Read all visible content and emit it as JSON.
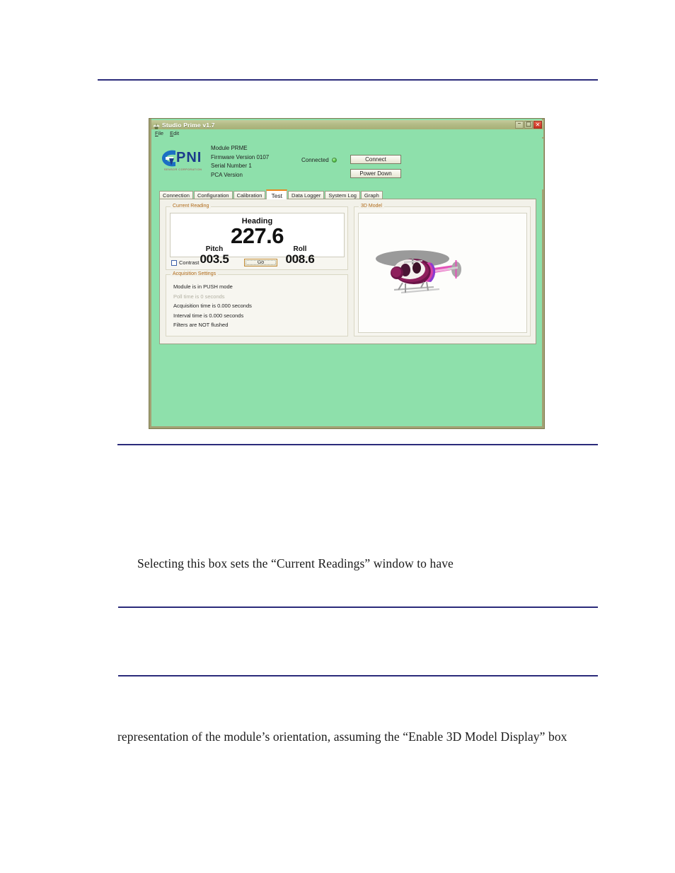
{
  "document": {
    "paragraph_1": "Selecting this box sets the “Current Readings” window to have",
    "paragraph_2": "representation of the module’s orientation, assuming the “Enable 3D Model Display” box",
    "rule_color": "#2b2b7a"
  },
  "app": {
    "title": "Studio Prime v1.7",
    "title_icon": "app-logo-icon",
    "window_buttons": {
      "minimize": "–",
      "maximize": "❐",
      "close": "✕"
    },
    "menu": [
      {
        "label": "File",
        "mnemonic": "F"
      },
      {
        "label": "Edit",
        "mnemonic": "E"
      }
    ],
    "colors": {
      "window_background": "#8ee0ab",
      "titlebar": "#b3bb86",
      "panel": "#f2f1e9",
      "group_legend": "#b06a18",
      "selected_tab_accent": "#e8861e",
      "led_green": "#4cc242",
      "logo_blue": "#1b3a8c"
    },
    "header": {
      "logo": {
        "wordmark": "PNI",
        "tagline": "SENSOR CORPORATION"
      },
      "module_info": [
        "Module PRME",
        "Firmware Version 0107",
        "Serial Number 1",
        "PCA Version"
      ],
      "connection": {
        "status_label": "Connected",
        "led": "connected-led",
        "connect_button": "Connect",
        "power_down_button": "Power Down"
      }
    },
    "tabs": [
      {
        "label": "Connection",
        "selected": false
      },
      {
        "label": "Configuration",
        "selected": false
      },
      {
        "label": "Calibration",
        "selected": false
      },
      {
        "label": "Test",
        "selected": true
      },
      {
        "label": "Data Logger",
        "selected": false
      },
      {
        "label": "System Log",
        "selected": false
      },
      {
        "label": "Graph",
        "selected": false
      }
    ],
    "current_reading": {
      "legend": "Current Reading",
      "heading_label": "Heading",
      "heading_value": "227.6",
      "pitch_label": "Pitch",
      "pitch_value": "003.5",
      "roll_label": "Roll",
      "roll_value": "008.6",
      "contrast_label": "Contrast",
      "contrast_checked": false,
      "go_button": "Go"
    },
    "acquisition_settings": {
      "legend": "Acquisition Settings",
      "lines": [
        {
          "text": "Module is in PUSH mode",
          "disabled": false
        },
        {
          "text": "Poll time is 0 seconds",
          "disabled": true
        },
        {
          "text": "Acquisition time is 0.000 seconds",
          "disabled": false
        },
        {
          "text": "Interval time is 0.000 seconds",
          "disabled": false
        },
        {
          "text": "Filters are NOT flushed",
          "disabled": false
        }
      ]
    },
    "model_3d": {
      "legend": "3D Model",
      "content": "helicopter-model"
    }
  }
}
